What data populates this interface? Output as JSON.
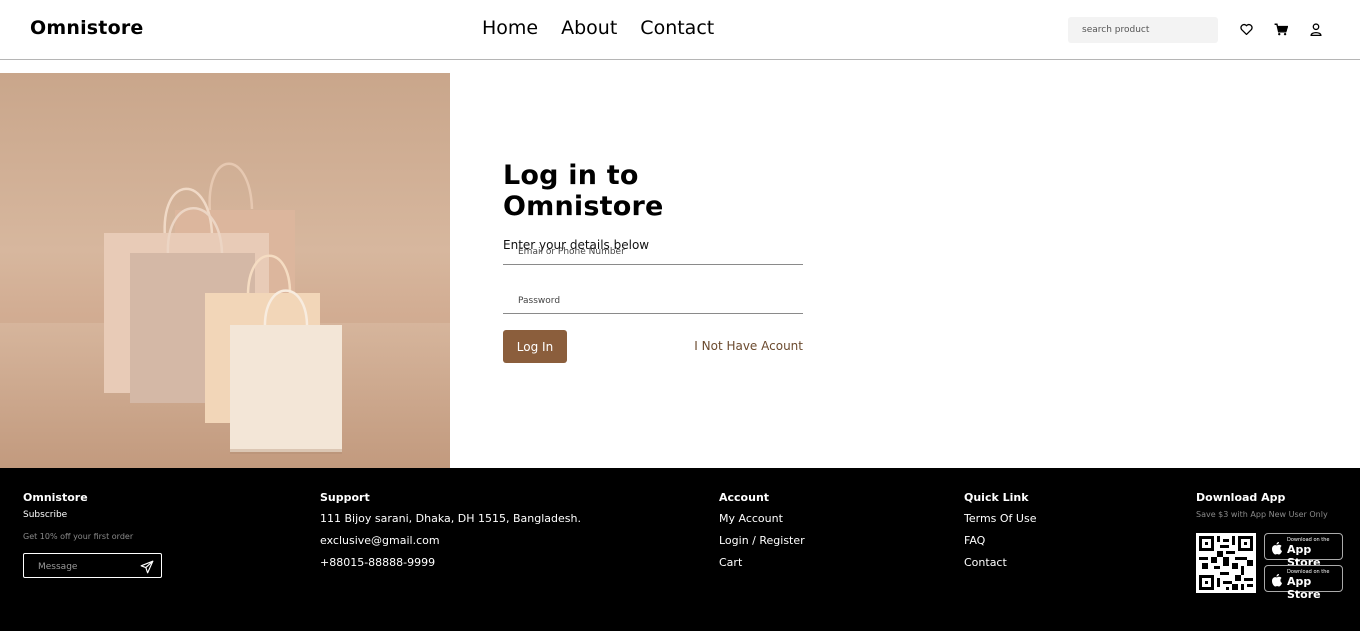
{
  "header": {
    "brand": "Omnistore",
    "nav": [
      "Home",
      "About",
      "Contact"
    ],
    "search_placeholder": "search product",
    "icons": [
      "heart-icon",
      "cart-icon",
      "user-icon"
    ]
  },
  "login": {
    "title": "Log in to Omnistore",
    "subtitle": "Enter your details below",
    "email_placeholder": "Email or Phone Number",
    "password_placeholder": "Password",
    "login_button": "Log In",
    "register_link": "I Not Have Acount"
  },
  "footer": {
    "brand": {
      "title": "Omnistore",
      "subscribe": "Subscribe",
      "offer": "Get 10% off your first order",
      "message_placeholder": "Message"
    },
    "support": {
      "title": "Support",
      "address": "111 Bijoy sarani, Dhaka, DH 1515, Bangladesh.",
      "email": "exclusive@gmail.com",
      "phone": "+88015-88888-9999"
    },
    "account": {
      "title": "Account",
      "links": [
        "My Account",
        "Login / Register",
        "Cart"
      ]
    },
    "quick_link": {
      "title": "Quick Link",
      "links": [
        "Terms Of Use",
        "FAQ",
        "Contact"
      ]
    },
    "download": {
      "title": "Download App",
      "note": "Save $3 with App New User Only",
      "store_small": "Download on the",
      "store_big": "App Store"
    }
  },
  "colors": {
    "accent": "#8b5e3c",
    "footer_bg": "#000000",
    "hero_bg": "#d2ad93"
  }
}
